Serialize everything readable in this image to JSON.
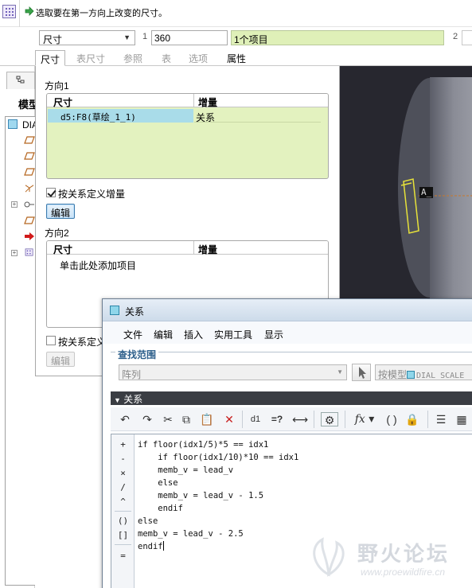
{
  "prompt": {
    "text": "选取要在第一方向上改变的尺寸。"
  },
  "dashboard": {
    "type_select": "尺寸",
    "dir1_label": "1",
    "dir1_count": "360",
    "dir1_items": "1个项目",
    "dir2_label": "2"
  },
  "tabs": [
    {
      "label": "尺寸",
      "state": "active"
    },
    {
      "label": "表尺寸",
      "state": "disabled"
    },
    {
      "label": "参照",
      "state": "disabled"
    },
    {
      "label": "表",
      "state": "disabled"
    },
    {
      "label": "选项",
      "state": "disabled"
    },
    {
      "label": "属性",
      "state": "normal"
    }
  ],
  "tree": {
    "title": "模型",
    "root": "DIAL"
  },
  "panel": {
    "direction1": {
      "title": "方向1",
      "columns": [
        "尺寸",
        "增量"
      ],
      "rows": [
        {
          "dimension": "d5:F8(草绘_1_1)",
          "increment": "关系"
        }
      ],
      "define_increment_label": "按关系定义增量",
      "define_increment_checked": true,
      "edit_button": "编辑"
    },
    "direction2": {
      "title": "方向2",
      "columns": [
        "尺寸",
        "增量"
      ],
      "add_item_hint": "单击此处添加项目",
      "define_increment_label": "按关系定义",
      "define_increment_checked": false,
      "edit_button": "编辑"
    }
  },
  "graphics": {
    "dim_tag": "A_"
  },
  "relations_dialog": {
    "title": "关系",
    "menu": [
      "文件",
      "编辑",
      "插入",
      "实用工具",
      "显示"
    ],
    "search_title": "查找范围",
    "search_scope": "阵列",
    "by_model_label": "按模型",
    "model_name": "DIAL_SCALE_",
    "section_title": "关系",
    "operators": [
      "+",
      "-",
      "×",
      "/",
      "^",
      "()",
      "[]",
      "="
    ],
    "code_lines": [
      "if floor(idx1/5)*5 == idx1",
      "    if floor(idx1/10)*10 == idx1",
      "    memb_v = lead_v",
      "    else",
      "    memb_v = lead_v - 1.5",
      "    endif",
      "else",
      "memb_v = lead_v - 2.5",
      "endif"
    ]
  },
  "watermark": {
    "text": "野火论坛",
    "url": "www.proewildfire.cn"
  },
  "colors": {
    "accent_green": "#dff0b8",
    "selection_blue": "#a9dce9",
    "graphics_bg": "#27272f",
    "dark_bar": "#3a3d43"
  }
}
